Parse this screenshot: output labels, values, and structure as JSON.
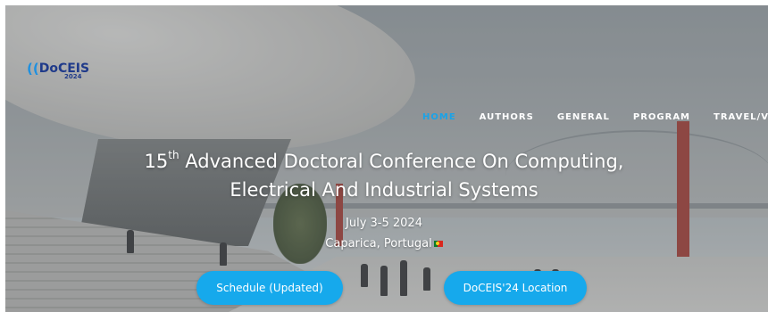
{
  "brand": {
    "logo_text": "DoCEIS",
    "logo_year": "2024",
    "icon": "broadcast-waves-icon",
    "logo_color": "#1f3a8a",
    "wave_color": "#1e90e0"
  },
  "nav": {
    "items": [
      {
        "label": "HOME",
        "active": true
      },
      {
        "label": "AUTHORS",
        "active": false
      },
      {
        "label": "GENERAL",
        "active": false
      },
      {
        "label": "PROGRAM",
        "active": false
      },
      {
        "label": "TRAVEL/VENUE",
        "active": false
      }
    ],
    "active_color": "#1aa3e8"
  },
  "hero": {
    "title_ordinal_number": "15",
    "title_ordinal_suffix": "th",
    "title_line1_rest": " Advanced Doctoral Conference On Computing,",
    "title_line2": "Electrical And Industrial Systems",
    "date": "July 3-5 2024",
    "location": "Caparica, Portugal",
    "location_icon": "portugal-flag-icon"
  },
  "buttons": {
    "schedule_label": "Schedule (Updated)",
    "location_label": "DoCEIS'24 Location",
    "color": "#16a9ec"
  }
}
